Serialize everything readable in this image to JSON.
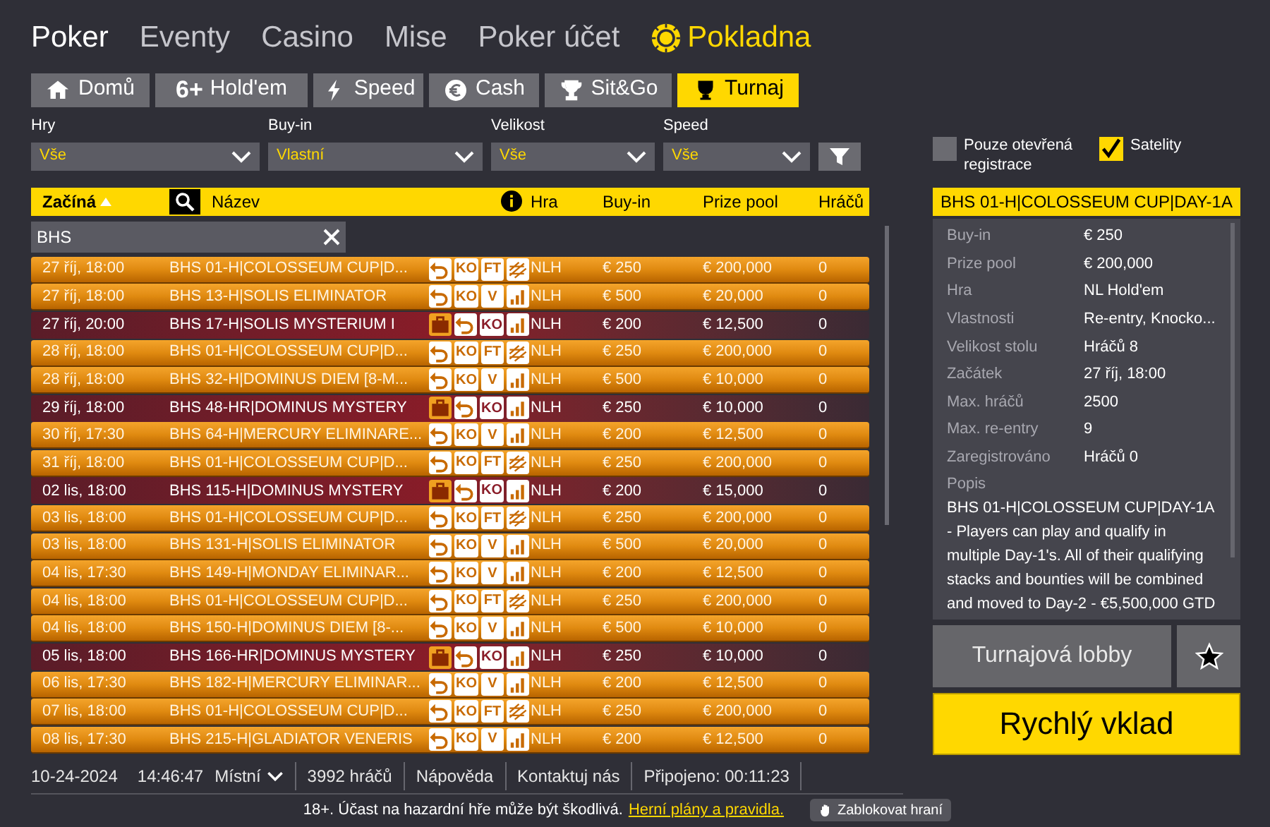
{
  "nav": [
    {
      "label": "Poker",
      "kind": "plain",
      "selected": true
    },
    {
      "label": "Eventy",
      "kind": "plain",
      "selected": false
    },
    {
      "label": "Casino",
      "kind": "plain",
      "selected": false
    },
    {
      "label": "Mise",
      "kind": "plain",
      "selected": false
    },
    {
      "label": "Poker účet",
      "kind": "plain",
      "selected": false
    },
    {
      "label": "Pokladna",
      "kind": "cashier",
      "selected": false
    }
  ],
  "tabs": [
    {
      "label": "Domů",
      "kind": "home",
      "selected": false
    },
    {
      "label": "Hold'em",
      "kind": "sixplus",
      "icon_text": "6+",
      "selected": false
    },
    {
      "label": "Speed",
      "kind": "bolt",
      "selected": false
    },
    {
      "label": "Cash",
      "kind": "euro",
      "selected": false
    },
    {
      "label": "Sit&Go",
      "kind": "trophy",
      "selected": false
    },
    {
      "label": "Turnaj",
      "kind": "cup",
      "selected": true
    }
  ],
  "filters": [
    {
      "label": "Hry",
      "value": "Vše"
    },
    {
      "label": "Buy-in",
      "value": "Vlastní"
    },
    {
      "label": "Velikost",
      "value": "Vše"
    },
    {
      "label": "Speed",
      "value": "Vše"
    }
  ],
  "checkboxes": [
    {
      "label": "Pouze otevřená registrace",
      "checked": false
    },
    {
      "label": "Satelity",
      "checked": true
    }
  ],
  "table": {
    "columns": {
      "start": "Začíná",
      "name": "Název",
      "game": "Hra",
      "buyin": "Buy-in",
      "prize": "Prize pool",
      "players": "Hráčů"
    },
    "search": {
      "value": "BHS"
    },
    "rows": [
      {
        "kind": "standard",
        "start": "27 říj, 18:00",
        "name": "BHS 01-H|COLOSSEUM CUP|D...",
        "badges": [
          {
            "kind": "reentry"
          },
          {
            "kind": "text",
            "text": "KO"
          },
          {
            "kind": "text",
            "text": "FT"
          },
          {
            "kind": "stripes"
          }
        ],
        "game": "NLH",
        "buyin": "€ 250",
        "prize": "€ 200,000",
        "players": "0"
      },
      {
        "kind": "standard",
        "start": "27 říj, 18:00",
        "name": "BHS 13-H|SOLIS ELIMINATOR",
        "badges": [
          {
            "kind": "reentry"
          },
          {
            "kind": "text",
            "text": "KO"
          },
          {
            "kind": "text",
            "text": "V"
          },
          {
            "kind": "bars"
          }
        ],
        "game": "NLH",
        "buyin": "€ 500",
        "prize": "€ 20,000",
        "players": "0"
      },
      {
        "kind": "mystery",
        "start": "27 říj, 20:00",
        "name": "BHS 17-H|SOLIS MYSTERIUM I",
        "badges": [
          {
            "kind": "bag"
          },
          {
            "kind": "reentry"
          },
          {
            "kind": "text",
            "text": "KO"
          },
          {
            "kind": "bars"
          }
        ],
        "game": "NLH",
        "buyin": "€ 200",
        "prize": "€ 12,500",
        "players": "0"
      },
      {
        "kind": "standard",
        "start": "28 říj, 18:00",
        "name": "BHS 01-H|COLOSSEUM CUP|D...",
        "badges": [
          {
            "kind": "reentry"
          },
          {
            "kind": "text",
            "text": "KO"
          },
          {
            "kind": "text",
            "text": "FT"
          },
          {
            "kind": "stripes"
          }
        ],
        "game": "NLH",
        "buyin": "€ 250",
        "prize": "€ 200,000",
        "players": "0"
      },
      {
        "kind": "standard",
        "start": "28 říj, 18:00",
        "name": "BHS 32-H|DOMINUS DIEM [8-M...",
        "badges": [
          {
            "kind": "reentry"
          },
          {
            "kind": "text",
            "text": "KO"
          },
          {
            "kind": "text",
            "text": "V"
          },
          {
            "kind": "bars"
          }
        ],
        "game": "NLH",
        "buyin": "€ 500",
        "prize": "€ 10,000",
        "players": "0"
      },
      {
        "kind": "mystery",
        "start": "29 říj, 18:00",
        "name": "BHS 48-HR|DOMINUS MYSTERY",
        "badges": [
          {
            "kind": "bag"
          },
          {
            "kind": "reentry"
          },
          {
            "kind": "text",
            "text": "KO"
          },
          {
            "kind": "bars"
          }
        ],
        "game": "NLH",
        "buyin": "€ 250",
        "prize": "€ 10,000",
        "players": "0"
      },
      {
        "kind": "standard",
        "start": "30 říj, 17:30",
        "name": "BHS 64-H|MERCURY ELIMINARE...",
        "badges": [
          {
            "kind": "reentry"
          },
          {
            "kind": "text",
            "text": "KO"
          },
          {
            "kind": "text",
            "text": "V"
          },
          {
            "kind": "bars"
          }
        ],
        "game": "NLH",
        "buyin": "€ 200",
        "prize": "€ 12,500",
        "players": "0"
      },
      {
        "kind": "standard",
        "start": "31 říj, 18:00",
        "name": "BHS 01-H|COLOSSEUM CUP|D...",
        "badges": [
          {
            "kind": "reentry"
          },
          {
            "kind": "text",
            "text": "KO"
          },
          {
            "kind": "text",
            "text": "FT"
          },
          {
            "kind": "stripes"
          }
        ],
        "game": "NLH",
        "buyin": "€ 250",
        "prize": "€ 200,000",
        "players": "0"
      },
      {
        "kind": "mystery",
        "start": "02 lis, 18:00",
        "name": "BHS 115-H|DOMINUS MYSTERY",
        "badges": [
          {
            "kind": "bag"
          },
          {
            "kind": "reentry"
          },
          {
            "kind": "text",
            "text": "KO"
          },
          {
            "kind": "bars"
          }
        ],
        "game": "NLH",
        "buyin": "€ 200",
        "prize": "€ 15,000",
        "players": "0"
      },
      {
        "kind": "standard",
        "start": "03 lis, 18:00",
        "name": "BHS 01-H|COLOSSEUM CUP|D...",
        "badges": [
          {
            "kind": "reentry"
          },
          {
            "kind": "text",
            "text": "KO"
          },
          {
            "kind": "text",
            "text": "FT"
          },
          {
            "kind": "stripes"
          }
        ],
        "game": "NLH",
        "buyin": "€ 250",
        "prize": "€ 200,000",
        "players": "0"
      },
      {
        "kind": "standard",
        "start": "03 lis, 18:00",
        "name": "BHS 131-H|SOLIS ELIMINATOR",
        "badges": [
          {
            "kind": "reentry"
          },
          {
            "kind": "text",
            "text": "KO"
          },
          {
            "kind": "text",
            "text": "V"
          },
          {
            "kind": "bars"
          }
        ],
        "game": "NLH",
        "buyin": "€ 500",
        "prize": "€ 20,000",
        "players": "0"
      },
      {
        "kind": "standard",
        "start": "04 lis, 17:30",
        "name": "BHS 149-H|MONDAY ELIMINAR...",
        "badges": [
          {
            "kind": "reentry"
          },
          {
            "kind": "text",
            "text": "KO"
          },
          {
            "kind": "text",
            "text": "V"
          },
          {
            "kind": "bars"
          }
        ],
        "game": "NLH",
        "buyin": "€ 200",
        "prize": "€ 12,500",
        "players": "0"
      },
      {
        "kind": "standard",
        "start": "04 lis, 18:00",
        "name": "BHS 01-H|COLOSSEUM CUP|D...",
        "badges": [
          {
            "kind": "reentry"
          },
          {
            "kind": "text",
            "text": "KO"
          },
          {
            "kind": "text",
            "text": "FT"
          },
          {
            "kind": "stripes"
          }
        ],
        "game": "NLH",
        "buyin": "€ 250",
        "prize": "€ 200,000",
        "players": "0"
      },
      {
        "kind": "standard",
        "start": "04 lis, 18:00",
        "name": "BHS 150-H|DOMINUS DIEM [8-...",
        "badges": [
          {
            "kind": "reentry"
          },
          {
            "kind": "text",
            "text": "KO"
          },
          {
            "kind": "text",
            "text": "V"
          },
          {
            "kind": "bars"
          }
        ],
        "game": "NLH",
        "buyin": "€ 500",
        "prize": "€ 10,000",
        "players": "0"
      },
      {
        "kind": "mystery",
        "start": "05 lis, 18:00",
        "name": "BHS 166-HR|DOMINUS MYSTERY",
        "badges": [
          {
            "kind": "bag"
          },
          {
            "kind": "reentry"
          },
          {
            "kind": "text",
            "text": "KO"
          },
          {
            "kind": "bars"
          }
        ],
        "game": "NLH",
        "buyin": "€ 250",
        "prize": "€ 10,000",
        "players": "0"
      },
      {
        "kind": "standard",
        "start": "06 lis, 17:30",
        "name": "BHS 182-H|MERCURY ELIMINAR...",
        "badges": [
          {
            "kind": "reentry"
          },
          {
            "kind": "text",
            "text": "KO"
          },
          {
            "kind": "text",
            "text": "V"
          },
          {
            "kind": "bars"
          }
        ],
        "game": "NLH",
        "buyin": "€ 200",
        "prize": "€ 12,500",
        "players": "0"
      },
      {
        "kind": "standard",
        "start": "07 lis, 18:00",
        "name": "BHS 01-H|COLOSSEUM CUP|D...",
        "badges": [
          {
            "kind": "reentry"
          },
          {
            "kind": "text",
            "text": "KO"
          },
          {
            "kind": "text",
            "text": "FT"
          },
          {
            "kind": "stripes"
          }
        ],
        "game": "NLH",
        "buyin": "€ 250",
        "prize": "€ 200,000",
        "players": "0"
      },
      {
        "kind": "standard",
        "start": "08 lis, 17:30",
        "name": "BHS 215-H|GLADIATOR VENERIS",
        "badges": [
          {
            "kind": "reentry"
          },
          {
            "kind": "text",
            "text": "KO"
          },
          {
            "kind": "text",
            "text": "V"
          },
          {
            "kind": "bars"
          }
        ],
        "game": "NLH",
        "buyin": "€ 200",
        "prize": "€ 12,500",
        "players": "0"
      }
    ]
  },
  "details": {
    "title": "BHS 01-H|COLOSSEUM CUP|DAY-1A",
    "fields": [
      {
        "label": "Buy-in",
        "value": "€ 250"
      },
      {
        "label": "Prize pool",
        "value": "€ 200,000"
      },
      {
        "label": "Hra",
        "value": "NL Hold'em"
      },
      {
        "label": "Vlastnosti",
        "value": "Re-entry, Knocko..."
      },
      {
        "label": "Velikost stolu",
        "value": "Hráčů 8"
      },
      {
        "label": "Začátek",
        "value": "27 říj, 18:00"
      },
      {
        "label": "Max. hráčů",
        "value": "2500"
      },
      {
        "label": "Max. re-entry",
        "value": "9"
      },
      {
        "label": "Zaregistrováno",
        "value": "Hráčů 0"
      }
    ],
    "description_label": "Popis",
    "description": "BHS 01-H|COLOSSEUM CUP|DAY-1A - Players can play and qualify in multiple Day-1's. All of their qualifying stacks and bounties will be combined and moved to Day-2 - €5,500,000 GTD",
    "lobby_button": "Turnajová lobby",
    "deposit_button": "Rychlý vklad"
  },
  "status_bar": {
    "date": "10-24-2024",
    "time": "14:46:47",
    "timezone": "Místní",
    "players": "3992 hráčů",
    "help": "Nápověda",
    "contact": "Kontaktuj nás",
    "connected": "Připojeno: 00:11:23"
  },
  "footer": {
    "disclaimer": "18+. Účast na hazardní hře může být škodlivá.",
    "link": "Herní plány a pravidla.",
    "block_button": "Zablokovat hraní"
  }
}
